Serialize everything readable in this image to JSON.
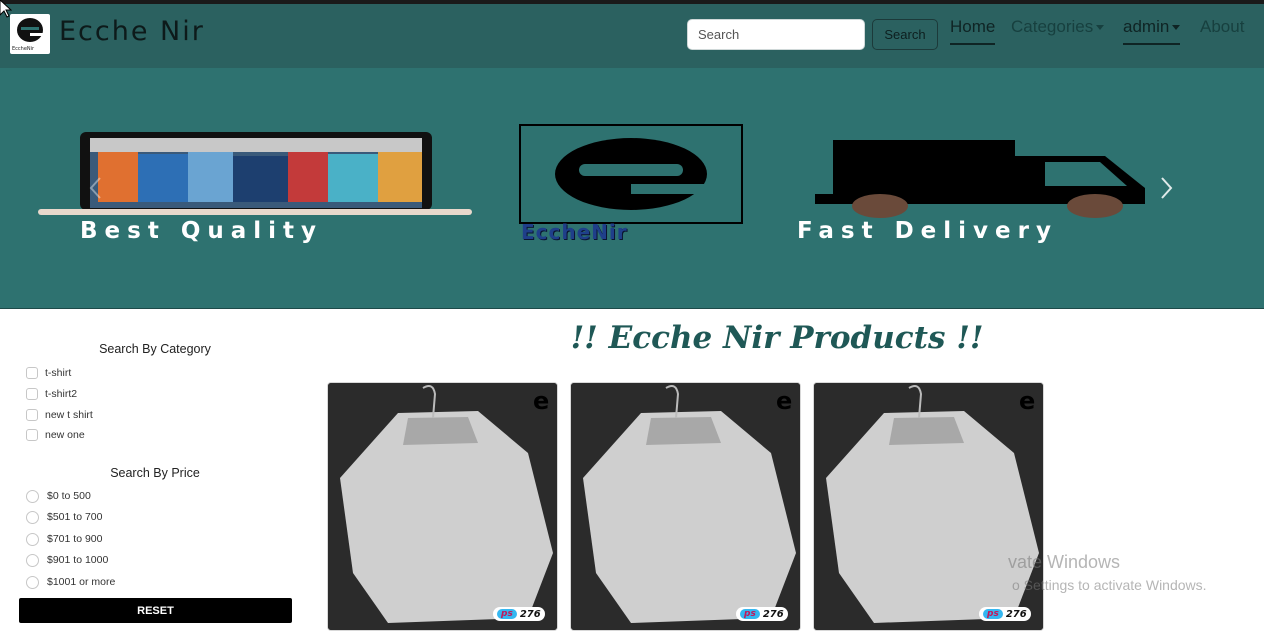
{
  "navbar": {
    "brand_name": "Ecche Nir",
    "logo_small_text": "EccheNir",
    "search_placeholder": "Search",
    "search_button": "Search",
    "links": {
      "home": "Home",
      "categories": "Categories",
      "admin": "admin",
      "about": "About"
    }
  },
  "hero": {
    "captions": [
      "Best Quality",
      "EccheNir",
      "Fast Delivery"
    ]
  },
  "sidebar": {
    "category_heading": "Search By Category",
    "categories": [
      "t-shirt",
      "t-shirt2",
      "new t shirt",
      "new one"
    ],
    "price_heading": "Search By Price",
    "prices": [
      "$0 to 500",
      "$501 to 700",
      "$701 to 900",
      "$901 to 1000",
      "$1001 or more"
    ],
    "reset_button": "RESET"
  },
  "products": {
    "title": "!! Ecche Nir Products !!",
    "items": [
      {
        "currency": "ps",
        "price": "276"
      },
      {
        "currency": "ps",
        "price": "276"
      },
      {
        "currency": "ps",
        "price": "276"
      }
    ]
  },
  "watermark": {
    "line1": "vate Windows",
    "line2": "o Settings to activate Windows."
  },
  "colors": {
    "navbar": "#2b6160",
    "hero": "#2e7270",
    "title": "#1f5856",
    "reset": "#000000"
  }
}
